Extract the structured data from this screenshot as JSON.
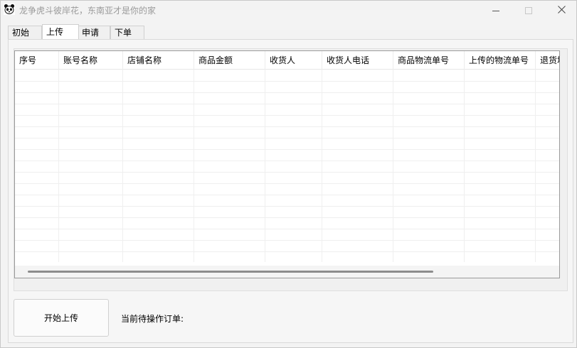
{
  "window": {
    "title": "龙争虎斗彼岸花，东南亚才是你的家"
  },
  "tabs": [
    {
      "label": "初始",
      "active": false
    },
    {
      "label": "上传",
      "active": true
    },
    {
      "label": "申请",
      "active": false
    },
    {
      "label": "下单",
      "active": false
    }
  ],
  "grid": {
    "columns": [
      "序号",
      "账号名称",
      "店铺名称",
      "商品金额",
      "收货人",
      "收货人电话",
      "商品物流单号",
      "上传的物流单号",
      "退货地址"
    ],
    "rows": []
  },
  "actions": {
    "start_upload_label": "开始上传",
    "pending_order_label": "当前待操作订单:"
  },
  "icons": {
    "app": "panda-icon",
    "minimize": "minimize-icon",
    "maximize": "maximize-icon",
    "close": "close-icon"
  }
}
